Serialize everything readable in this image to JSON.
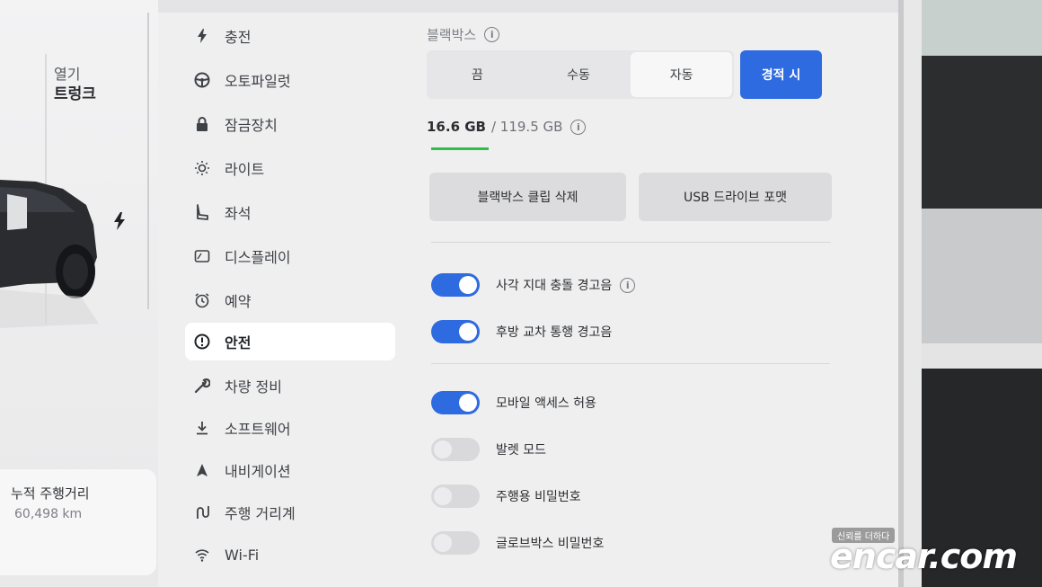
{
  "car_panel": {
    "trunk_label_1": "열기",
    "trunk_label_2": "트렁크",
    "odometer_label": "누적 주행거리",
    "odometer_value": "60,498 km"
  },
  "nav": {
    "items": [
      {
        "label": "충전",
        "icon": "lightning-icon"
      },
      {
        "label": "오토파일럿",
        "icon": "steering-wheel-icon"
      },
      {
        "label": "잠금장치",
        "icon": "lock-icon"
      },
      {
        "label": "라이트",
        "icon": "sun-icon"
      },
      {
        "label": "좌석",
        "icon": "seat-icon"
      },
      {
        "label": "디스플레이",
        "icon": "display-icon"
      },
      {
        "label": "예약",
        "icon": "alarm-clock-icon"
      },
      {
        "label": "안전",
        "icon": "alert-circle-icon"
      },
      {
        "label": "차량 정비",
        "icon": "wrench-icon"
      },
      {
        "label": "소프트웨어",
        "icon": "download-icon"
      },
      {
        "label": "내비게이션",
        "icon": "navigation-arrow-icon"
      },
      {
        "label": "주행 거리계",
        "icon": "trip-icon"
      },
      {
        "label": "Wi-Fi",
        "icon": "wifi-icon"
      }
    ],
    "active_index": 7
  },
  "dashcam": {
    "title": "블랙박스",
    "options": [
      "끔",
      "수동",
      "자동"
    ],
    "selected": "자동",
    "sentry_button": "경적 시"
  },
  "storage": {
    "used": "16.6 GB",
    "separator_total": "/ 119.5 GB",
    "used_fraction": 0.139
  },
  "actions": {
    "delete_clips": "블랙박스 클립 삭제",
    "format_usb": "USB 드라이브 포맷"
  },
  "toggles": [
    {
      "label": "사각 지대 충돌 경고음",
      "on": true,
      "info": true
    },
    {
      "label": "후방 교차 통행 경고음",
      "on": true,
      "info": false
    },
    {
      "label": "모바일 액세스 허용",
      "on": true,
      "info": false
    },
    {
      "label": "발렛 모드",
      "on": false,
      "info": false
    },
    {
      "label": "주행용 비밀번호",
      "on": false,
      "info": false
    },
    {
      "label": "글로브박스 비밀번호",
      "on": false,
      "info": false
    }
  ],
  "colors": {
    "accent_blue": "#2e6ae0",
    "storage_green": "#2dbf4a"
  },
  "watermark": {
    "tagline": "신뢰를 더하다",
    "logo": "encar.com"
  }
}
